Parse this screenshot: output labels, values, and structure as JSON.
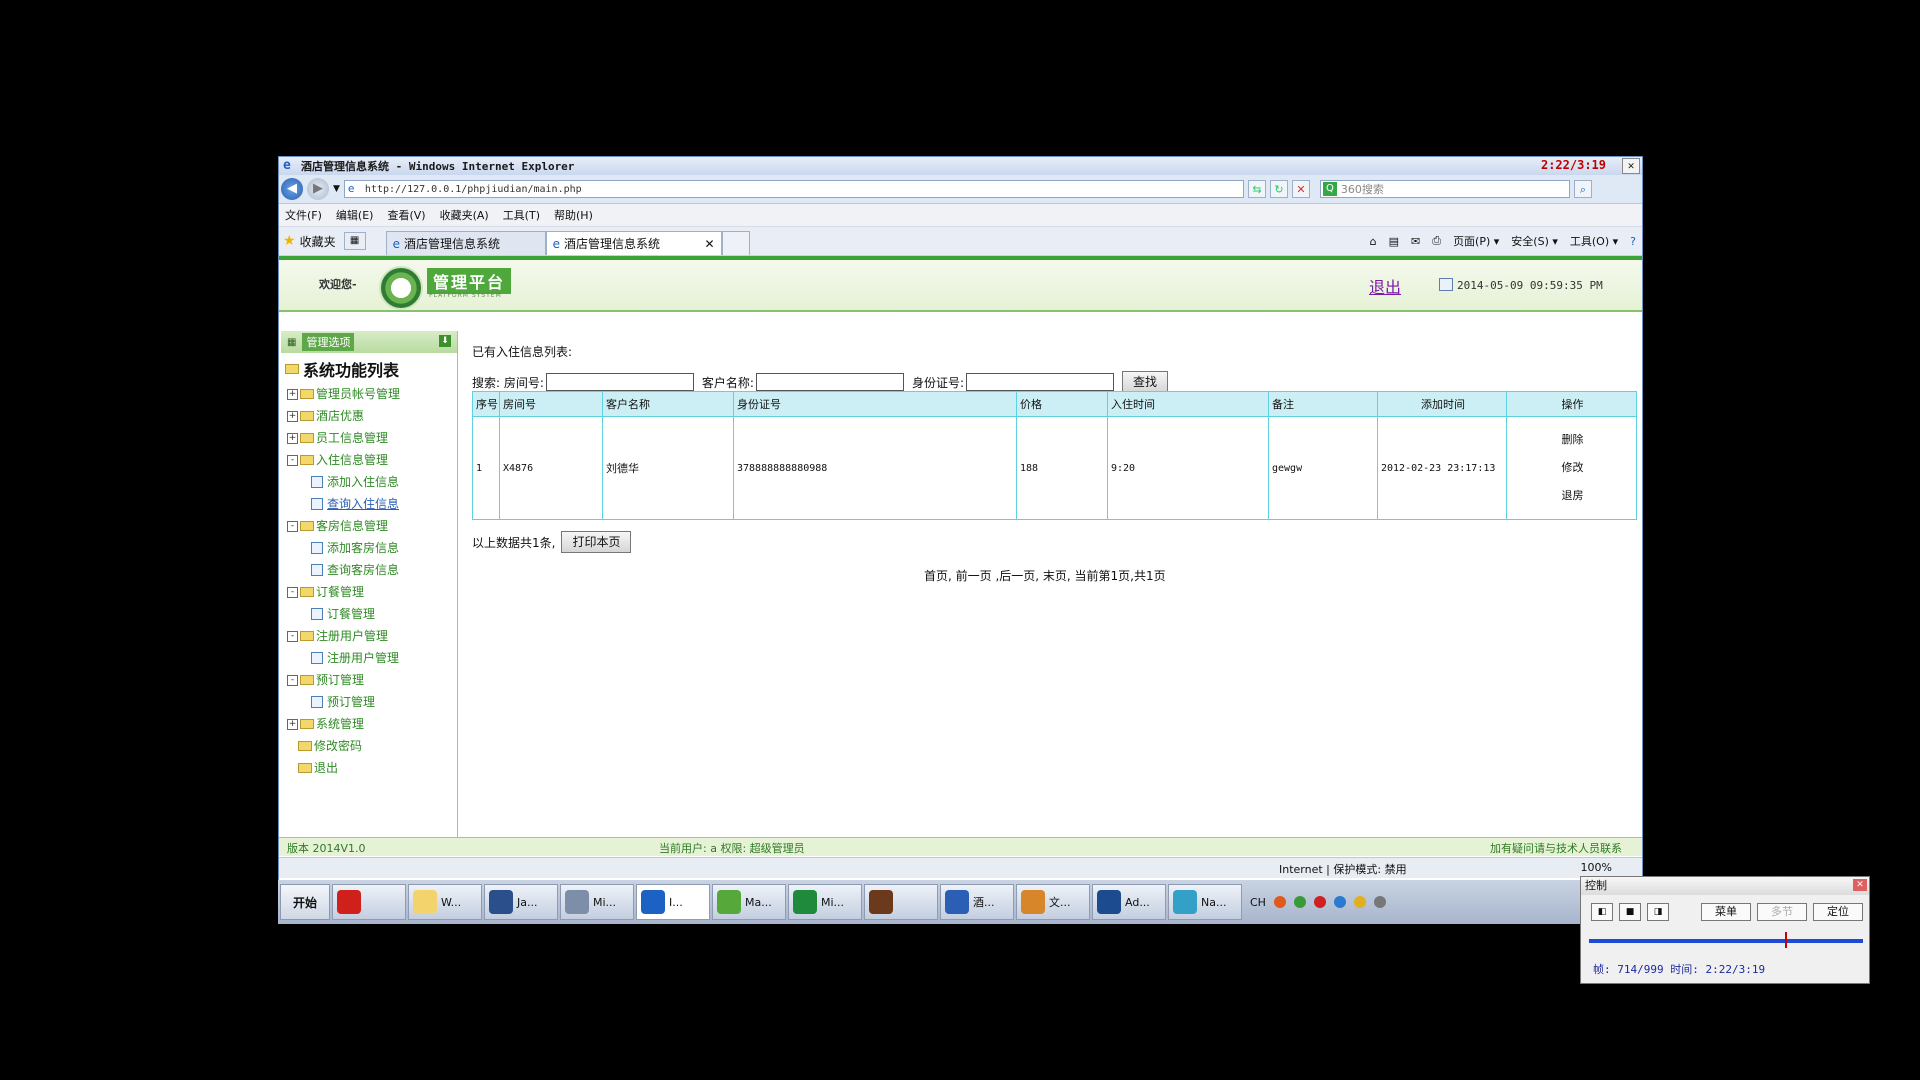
{
  "window": {
    "title": "酒店管理信息系统 - Windows Internet Explorer",
    "time_overlay": "2:22/3:19",
    "close": "✕"
  },
  "address": {
    "url": "http://127.0.0.1/phpjiudian/main.php",
    "search_placeholder": "360搜索"
  },
  "menu": [
    "文件(F)",
    "编辑(E)",
    "查看(V)",
    "收藏夹(A)",
    "工具(T)",
    "帮助(H)"
  ],
  "favbar": {
    "favorites": "收藏夹",
    "tabs": [
      {
        "label": "酒店管理信息系统"
      },
      {
        "label": "酒店管理信息系统"
      }
    ],
    "commands": [
      "页面(P) ▾",
      "安全(S) ▾",
      "工具(O) ▾"
    ]
  },
  "app_header": {
    "welcome": "欢迎您-",
    "logo_title": "管理平台",
    "logo_sub": "PLATFORM SYSTEM",
    "logout": "退出",
    "datetime": "2014-05-09 09:59:35 PM"
  },
  "sidebar": {
    "header": "管理选项",
    "title": "系统功能列表",
    "items": [
      {
        "label": "管理员帐号管理",
        "level": 0,
        "expander": "+"
      },
      {
        "label": "酒店优惠",
        "level": 0,
        "expander": "+"
      },
      {
        "label": "员工信息管理",
        "level": 0,
        "expander": "+"
      },
      {
        "label": "入住信息管理",
        "level": 0,
        "expander": "-"
      },
      {
        "label": "添加入住信息",
        "level": 1
      },
      {
        "label": "查询入住信息",
        "level": 1,
        "selected": true
      },
      {
        "label": "客房信息管理",
        "level": 0,
        "expander": "-"
      },
      {
        "label": "添加客房信息",
        "level": 1
      },
      {
        "label": "查询客房信息",
        "level": 1
      },
      {
        "label": "订餐管理",
        "level": 0,
        "expander": "-"
      },
      {
        "label": "订餐管理",
        "level": 1
      },
      {
        "label": "注册用户管理",
        "level": 0,
        "expander": "-"
      },
      {
        "label": "注册用户管理",
        "level": 1
      },
      {
        "label": "预订管理",
        "level": 0,
        "expander": "-"
      },
      {
        "label": "预订管理",
        "level": 1
      },
      {
        "label": "系统管理",
        "level": 0,
        "expander": "+"
      },
      {
        "label": "修改密码",
        "level": 0
      },
      {
        "label": "退出",
        "level": 0
      }
    ]
  },
  "main": {
    "title": "已有入住信息列表:",
    "search": {
      "label": "搜索:",
      "room_label": "房间号:",
      "customer_label": "客户名称:",
      "id_label": "身份证号:",
      "button": "查找"
    },
    "table": {
      "headers": [
        "序号",
        "房间号",
        "客户名称",
        "身份证号",
        "价格",
        "入住时间",
        "备注",
        "添加时间",
        "操作"
      ],
      "rows": [
        {
          "no": "1",
          "room": "X4876",
          "customer": "刘德华",
          "id": "378888888880988",
          "price": "188",
          "checkin": "9:20",
          "note": "gewgw",
          "added": "2012-02-23 23:17:13",
          "ops": [
            "删除",
            "修改",
            "退房"
          ]
        }
      ]
    },
    "summary": "以上数据共1条,",
    "print_button": "打印本页",
    "pager": "首页, 前一页 ,后一页, 末页, 当前第1页,共1页"
  },
  "app_status": {
    "version": "版本 2014V1.0",
    "current_user": "当前用户: a  权限: 超级管理员",
    "contact": "加有疑问请与技术人员联系"
  },
  "ie_status": {
    "zone": "Internet | 保护模式: 禁用",
    "zoom": "100%"
  },
  "taskbar": {
    "start": "开始",
    "items": [
      {
        "label": "",
        "color": "#d0201c"
      },
      {
        "label": "W...",
        "color": "#f3d36b"
      },
      {
        "label": "Ja...",
        "color": "#2a4f8a"
      },
      {
        "label": "Mi...",
        "color": "#7d8fa8"
      },
      {
        "label": "I...",
        "color": "#1b62c4"
      },
      {
        "label": "Ma...",
        "color": "#56a83b"
      },
      {
        "label": "Mi...",
        "color": "#1f8a3b"
      },
      {
        "label": "",
        "color": "#6b3a1c"
      },
      {
        "label": "酒...",
        "color": "#2b5fb5"
      },
      {
        "label": "文...",
        "color": "#d7862a"
      },
      {
        "label": "Ad...",
        "color": "#1d4b8f"
      },
      {
        "label": "Na...",
        "color": "#33a0c8"
      }
    ],
    "tray_lang": "CH"
  },
  "control_panel": {
    "title": "控制",
    "buttons": [
      "菜单",
      "多节",
      "定位"
    ],
    "info": "帧: 714/999 时间: 2:22/3:19",
    "progress": 0.714
  }
}
